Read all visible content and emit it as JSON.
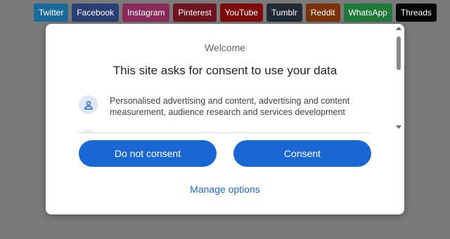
{
  "social": [
    {
      "label": "Twitter",
      "color": "#1b6a9c"
    },
    {
      "label": "Facebook",
      "color": "#2a3f73"
    },
    {
      "label": "Instagram",
      "color": "#8a2a58"
    },
    {
      "label": "Pinterest",
      "color": "#6e1420"
    },
    {
      "label": "YouTube",
      "color": "#7e0b0b"
    },
    {
      "label": "Tumblr",
      "color": "#222a33"
    },
    {
      "label": "Reddit",
      "color": "#7c3208"
    },
    {
      "label": "WhatsApp",
      "color": "#1f7a3a"
    },
    {
      "label": "Threads",
      "color": "#060606"
    }
  ],
  "dialog": {
    "welcome": "Welcome",
    "title": "This site asks for consent to use your data",
    "purpose_text": "Personalised advertising and content, advertising and content measurement, audience research and services development",
    "do_not_consent_label": "Do not consent",
    "consent_label": "Consent",
    "manage_label": "Manage options"
  },
  "colors": {
    "accent": "#1967d2",
    "icon_bg": "#dde8f7"
  },
  "icons": {
    "purpose": "person-icon"
  }
}
